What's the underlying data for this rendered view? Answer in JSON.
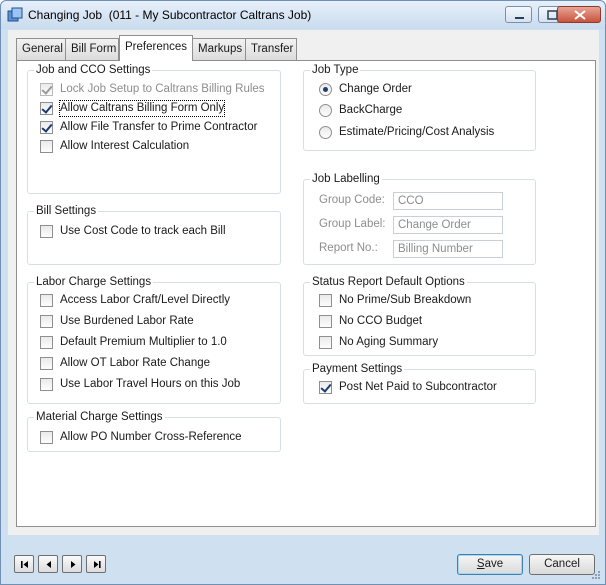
{
  "window": {
    "title": "Changing Job  (011 - My Subcontractor Caltrans Job)",
    "icons": {
      "app": "job-app-icon",
      "minimize": "minimize-icon",
      "maximize": "maximize-icon",
      "close": "close-icon"
    }
  },
  "tabs": [
    {
      "label": "General",
      "active": false
    },
    {
      "label": "Bill Form",
      "active": false
    },
    {
      "label": "Preferences",
      "active": true
    },
    {
      "label": "Markups",
      "active": false
    },
    {
      "label": "Transfer",
      "active": false
    }
  ],
  "job_cco": {
    "title": "Job and CCO Settings",
    "items": [
      {
        "label": "Lock Job Setup to Caltrans Billing Rules",
        "checked": true,
        "enabled": false
      },
      {
        "label": "Allow Caltrans Billing Form Only",
        "checked": true,
        "enabled": true
      },
      {
        "label": "Allow File Transfer to Prime Contractor",
        "checked": true,
        "enabled": true
      },
      {
        "label": "Allow Interest Calculation",
        "checked": false,
        "enabled": true
      }
    ]
  },
  "bill": {
    "title": "Bill Settings",
    "items": [
      {
        "label": "Use Cost Code to track each Bill",
        "checked": false
      }
    ]
  },
  "labor": {
    "title": "Labor Charge Settings",
    "items": [
      {
        "label": "Access Labor Craft/Level Directly",
        "checked": false
      },
      {
        "label": "Use Burdened Labor Rate",
        "checked": false
      },
      {
        "label": "Default Premium Multiplier to 1.0",
        "checked": false
      },
      {
        "label": "Allow OT Labor Rate Change",
        "checked": false
      },
      {
        "label": "Use Labor Travel Hours on this Job",
        "checked": false
      }
    ]
  },
  "material": {
    "title": "Material Charge Settings",
    "items": [
      {
        "label": "Allow PO Number Cross-Reference",
        "checked": false
      }
    ]
  },
  "job_type": {
    "title": "Job Type",
    "selected": "Change Order",
    "options": [
      "Change Order",
      "BackCharge",
      "Estimate/Pricing/Cost Analysis"
    ]
  },
  "labelling": {
    "title": "Job Labelling",
    "fields": [
      {
        "label": "Group Code:",
        "value": "CCO"
      },
      {
        "label": "Group Label:",
        "value": "Change Order"
      },
      {
        "label": "Report No.:",
        "value": "Billing Number"
      }
    ]
  },
  "status_report": {
    "title": "Status Report Default Options",
    "items": [
      {
        "label": "No Prime/Sub Breakdown",
        "checked": false
      },
      {
        "label": "No CCO Budget",
        "checked": false
      },
      {
        "label": "No Aging Summary",
        "checked": false
      }
    ]
  },
  "payment": {
    "title": "Payment Settings",
    "items": [
      {
        "label": "Post Net Paid to Subcontractor",
        "checked": true
      }
    ]
  },
  "footer": {
    "nav_icons": [
      "first-record-icon",
      "previous-record-icon",
      "next-record-icon",
      "last-record-icon"
    ],
    "save_prefix": "",
    "save_accel": "S",
    "save_rest": "ave",
    "cancel_label": "Cancel"
  }
}
